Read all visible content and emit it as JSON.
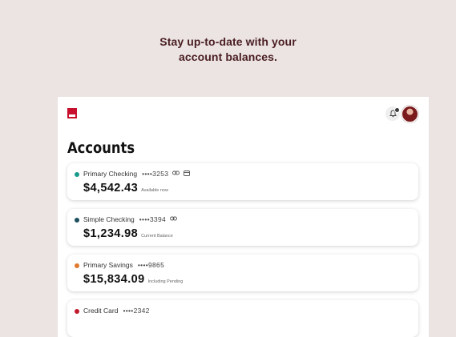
{
  "headline": {
    "line1": "Stay up-to-date with your",
    "line2": "account balances."
  },
  "header": {
    "logo_icon": "bank-logo-icon",
    "bell_icon": "bell-icon",
    "avatar_icon": "user-avatar"
  },
  "page_title": "Accounts",
  "accounts": [
    {
      "name": "Primary Checking",
      "number": "••••3253",
      "amount": "$4,542.43",
      "status": "Available now",
      "dot_color": "#1a9a8a",
      "icons": [
        "link-icon",
        "card-icon"
      ]
    },
    {
      "name": "Simple Checking",
      "number": "••••3394",
      "amount": "$1,234.98",
      "status": "Current Balance",
      "dot_color": "#1d4f5e",
      "icons": [
        "link-icon"
      ]
    },
    {
      "name": "Primary Savings",
      "number": "••••9865",
      "amount": "$15,834.09",
      "status": "Including Pending",
      "dot_color": "#e07a2e",
      "icons": []
    },
    {
      "name": "Credit Card",
      "number": "••••2342",
      "amount": "",
      "status": "",
      "dot_color": "#c0192a",
      "icons": []
    }
  ],
  "colors": {
    "background": "#ebe4e2",
    "headline": "#4a1e22",
    "brand_red": "#c8102e"
  }
}
